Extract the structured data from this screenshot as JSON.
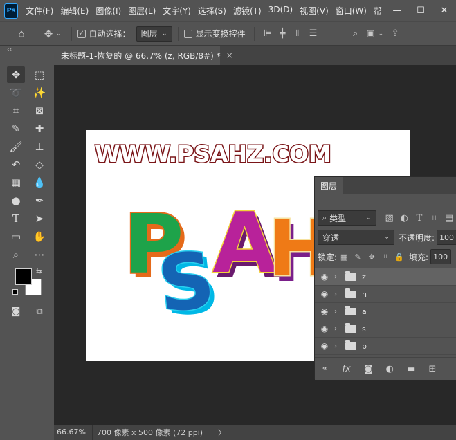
{
  "app": {
    "logo_text": "Ps"
  },
  "menu": {
    "items": [
      "文件(F)",
      "编辑(E)",
      "图像(I)",
      "图层(L)",
      "文字(Y)",
      "选择(S)",
      "滤镜(T)",
      "3D(D)",
      "视图(V)",
      "窗口(W)",
      "帮"
    ],
    "window_controls": {
      "minimize": "—",
      "maximize": "☐",
      "close": "✕"
    }
  },
  "options_bar": {
    "auto_select_label": "自动选择：",
    "auto_select_checked": true,
    "auto_select_target": "图层",
    "show_transform_label": "显示变换控件",
    "show_transform_checked": false
  },
  "toolbar": {
    "collapse_glyph": "‹‹"
  },
  "document": {
    "tab_title": "未标题-1-恢复的 @ 66.7% (z, RGB/8#) *",
    "tab_close": "×"
  },
  "canvas_art": {
    "watermark": "WWW.PSAHZ.COM",
    "letters": [
      "P",
      "S",
      "A",
      "H"
    ]
  },
  "status": {
    "zoom": "66.67%",
    "doc_info": "700 像素 x 500 像素 (72 ppi)",
    "arrow": "〉"
  },
  "layers_panel": {
    "tab_label": "图层",
    "filter_label": "类型",
    "blend_mode": "穿透",
    "opacity_label": "不透明度:",
    "opacity_value": "100",
    "lock_label": "锁定:",
    "fill_label": "填充:",
    "fill_value": "100",
    "layers": [
      {
        "name": "z",
        "selected": true
      },
      {
        "name": "h",
        "selected": false
      },
      {
        "name": "a",
        "selected": false
      },
      {
        "name": "s",
        "selected": false
      },
      {
        "name": "p",
        "selected": false
      }
    ]
  }
}
